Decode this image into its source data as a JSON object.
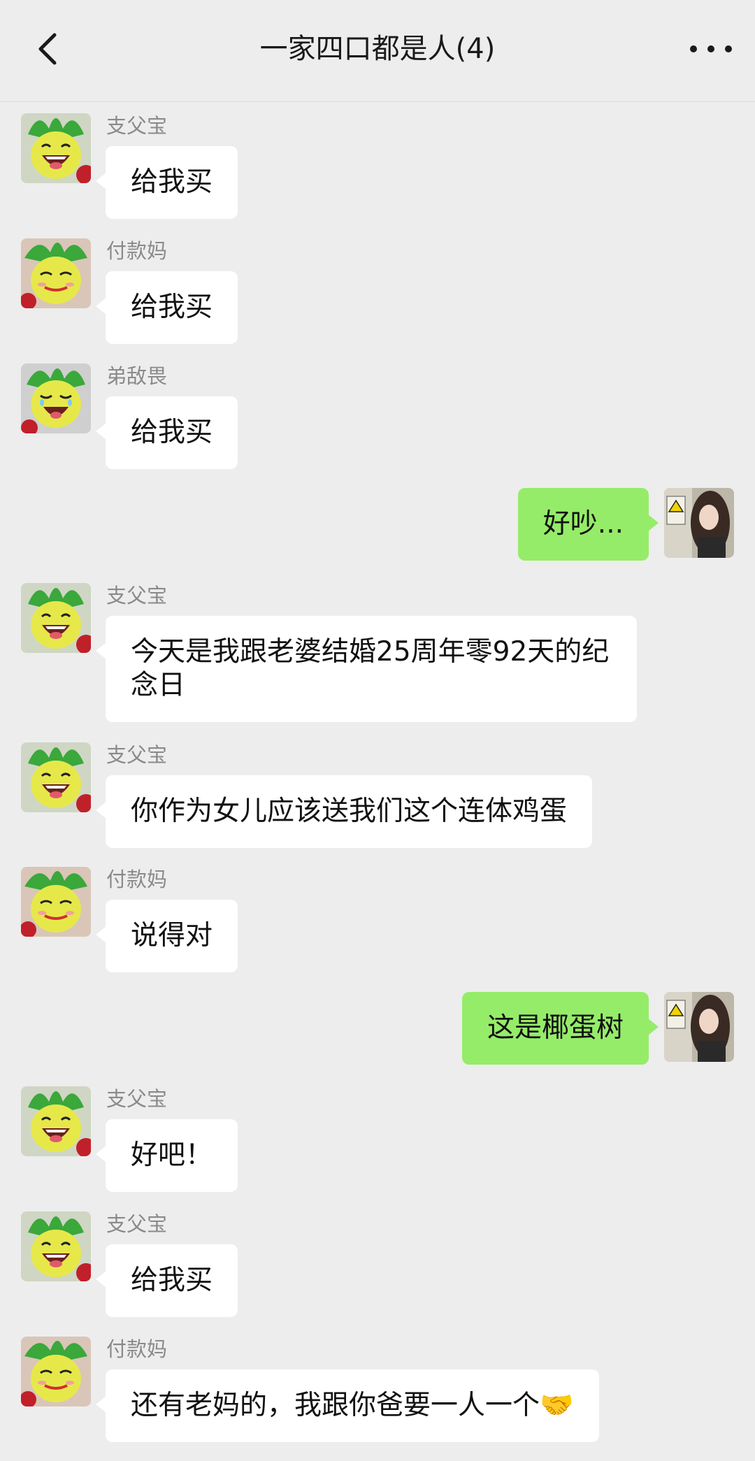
{
  "header": {
    "title": "一家四口都是人(4)",
    "back_icon": "chevron-left-icon",
    "more_icon": "more-dots-icon"
  },
  "messages": [
    {
      "side": "left",
      "sender": "支父宝",
      "text": "给我买",
      "avatar": "radish-grin-avatar"
    },
    {
      "side": "left",
      "sender": "付款妈",
      "text": "给我买",
      "avatar": "radish-smirk-avatar"
    },
    {
      "side": "left",
      "sender": "弟敌畏",
      "text": "给我买",
      "avatar": "radish-tear-avatar"
    },
    {
      "side": "right",
      "text": "好吵...",
      "avatar": "girl-photo-avatar"
    },
    {
      "side": "left",
      "sender": "支父宝",
      "text": "今天是我跟老婆结婚25周年零92天的纪念日",
      "avatar": "radish-grin-avatar"
    },
    {
      "side": "left",
      "sender": "支父宝",
      "text": "你作为女儿应该送我们这个连体鸡蛋",
      "avatar": "radish-grin-avatar"
    },
    {
      "side": "left",
      "sender": "付款妈",
      "text": "说得对",
      "avatar": "radish-smirk-avatar"
    },
    {
      "side": "right",
      "text": "这是椰蛋树",
      "avatar": "girl-photo-avatar"
    },
    {
      "side": "left",
      "sender": "支父宝",
      "text": "好吧！",
      "avatar": "radish-grin-avatar"
    },
    {
      "side": "left",
      "sender": "支父宝",
      "text": "给我买",
      "avatar": "radish-grin-avatar"
    },
    {
      "side": "left",
      "sender": "付款妈",
      "text": "还有老妈的，我跟你爸要一人一个🤝",
      "avatar": "radish-smirk-avatar"
    }
  ],
  "colors": {
    "background": "#ededed",
    "bubble_self": "#95ec69",
    "bubble_other": "#ffffff",
    "sender_name": "#8a8a8a"
  }
}
